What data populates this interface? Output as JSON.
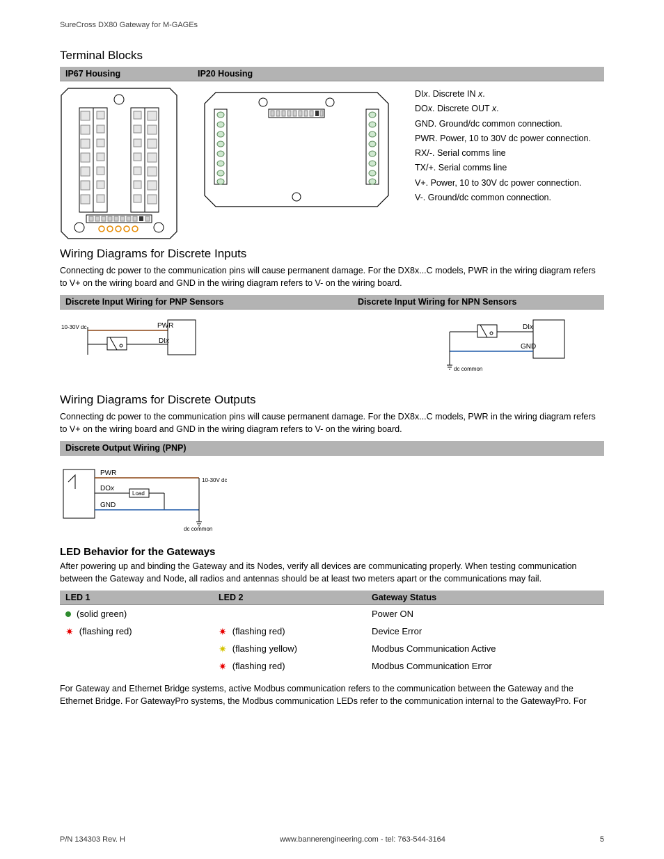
{
  "header": {
    "running": "SureCross DX80 Gateway for M-GAGEs"
  },
  "terminal": {
    "title": "Terminal Blocks",
    "col1": "IP67 Housing",
    "col2": "IP20 Housing",
    "defs": [
      {
        "term": "DIx.",
        "desc": " Discrete IN x."
      },
      {
        "term": "DOx.",
        "desc": " Discrete OUT x."
      },
      {
        "term": "GND.",
        "desc": " Ground/dc common connection."
      },
      {
        "term": "PWR.",
        "desc": " Power, 10 to 30V dc power connection."
      },
      {
        "term": "RX/-.",
        "desc": " Serial comms line"
      },
      {
        "term": "TX/+.",
        "desc": " Serial comms line"
      },
      {
        "term": "V+.",
        "desc": " Power, 10 to 30V dc power connection."
      },
      {
        "term": "V-.",
        "desc": " Ground/dc common connection."
      }
    ]
  },
  "inputs": {
    "title": "Wiring Diagrams for Discrete Inputs",
    "body": "Connecting dc power to the communication pins will cause permanent damage. For the DX8x...C models, PWR in the wiring diagram refers to V+ on the wiring board and GND in the wiring diagram refers to V- on the wiring board.",
    "col1": "Discrete Input Wiring for PNP Sensors",
    "col2": "Discrete Input Wiring for NPN Sensors",
    "pnp": {
      "vlabel": "10-30V dc",
      "pwr": "PWR",
      "di": "DIx"
    },
    "npn": {
      "di": "DIx",
      "gnd": "GND",
      "common": "dc common"
    }
  },
  "outputs": {
    "title": "Wiring Diagrams for Discrete Outputs",
    "body": "Connecting dc power to the communication pins will cause permanent damage. For the DX8x...C models, PWR in the wiring diagram refers to V+ on the wiring board and GND in the wiring diagram refers to V- on the wiring board.",
    "col1": "Discrete Output Wiring (PNP)",
    "diag": {
      "pwr": "PWR",
      "dox": "DOx",
      "gnd": "GND",
      "load": "Load",
      "v": "10-30V dc",
      "common": "dc common"
    }
  },
  "led": {
    "title": "LED Behavior for the Gateways",
    "body": "After powering up and binding the Gateway and its Nodes, verify all devices are communicating properly. When testing communication between the Gateway and Node, all radios and antennas should be at least two meters apart or the communications may fail.",
    "h1": "LED 1",
    "h2": "LED 2",
    "h3": "Gateway Status",
    "rows": [
      {
        "l1": "(solid green)",
        "l1icon": "green-dot",
        "l2": "",
        "l2icon": "",
        "status": "Power ON"
      },
      {
        "l1": "(flashing red)",
        "l1icon": "red-flash",
        "l2": "(flashing red)",
        "l2icon": "red-flash",
        "status": "Device Error"
      },
      {
        "l1": "",
        "l1icon": "",
        "l2": "(flashing yellow)",
        "l2icon": "yellow-flash",
        "status": "Modbus Communication Active"
      },
      {
        "l1": "",
        "l1icon": "",
        "l2": "(flashing red)",
        "l2icon": "red-flash",
        "status": "Modbus Communication Error"
      }
    ],
    "after": "For Gateway and Ethernet Bridge systems, active Modbus communication refers to the communication between the Gateway and the Ethernet Bridge. For GatewayPro systems, the Modbus communication LEDs refer to the communication internal to the GatewayPro. For"
  },
  "footer": {
    "left": "P/N 134303 Rev. H",
    "center": "www.bannerengineering.com - tel: 763-544-3164",
    "right": "5"
  }
}
